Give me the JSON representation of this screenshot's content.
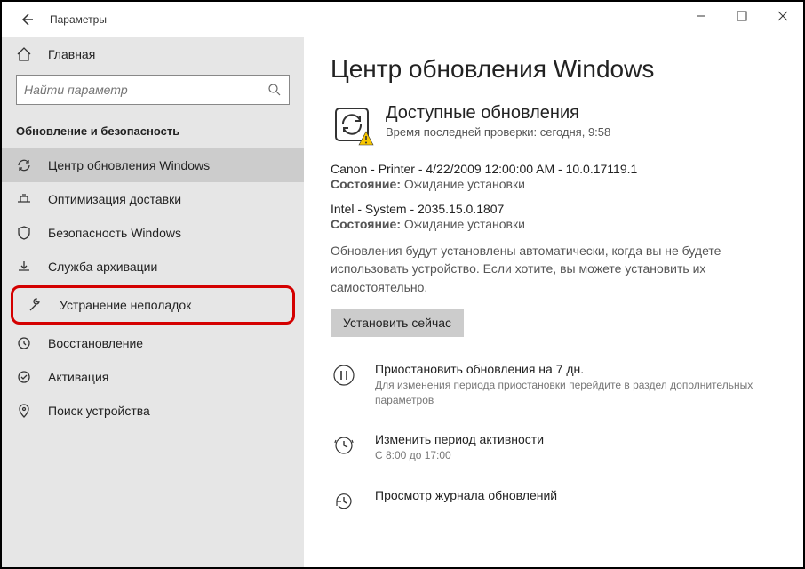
{
  "titlebar": {
    "title": "Параметры"
  },
  "sidebar": {
    "home": "Главная",
    "search_placeholder": "Найти параметр",
    "section": "Обновление и безопасность",
    "items": [
      {
        "label": "Центр обновления Windows"
      },
      {
        "label": "Оптимизация доставки"
      },
      {
        "label": "Безопасность Windows"
      },
      {
        "label": "Служба архивации"
      },
      {
        "label": "Устранение неполадок"
      },
      {
        "label": "Восстановление"
      },
      {
        "label": "Активация"
      },
      {
        "label": "Поиск устройства"
      }
    ]
  },
  "main": {
    "title": "Центр обновления Windows",
    "headline": "Доступные обновления",
    "lastcheck": "Время последней проверки: сегодня, 9:58",
    "updates": [
      {
        "name": "Canon - Printer - 4/22/2009 12:00:00 AM - 10.0.17119.1",
        "state_label": "Состояние:",
        "state_value": "Ожидание установки"
      },
      {
        "name": "Intel - System - 2035.15.0.1807",
        "state_label": "Состояние:",
        "state_value": "Ожидание установки"
      }
    ],
    "auto_note": "Обновления будут установлены автоматически, когда вы не будете использовать устройство. Если хотите, вы можете установить их самостоятельно.",
    "install_btn": "Установить сейчас",
    "actions": [
      {
        "headline": "Приостановить обновления на 7 дн.",
        "sub": "Для изменения периода приостановки перейдите в раздел дополнительных параметров"
      },
      {
        "headline": "Изменить период активности",
        "sub": "С 8:00 до 17:00"
      },
      {
        "headline": "Просмотр журнала обновлений",
        "sub": ""
      }
    ]
  }
}
